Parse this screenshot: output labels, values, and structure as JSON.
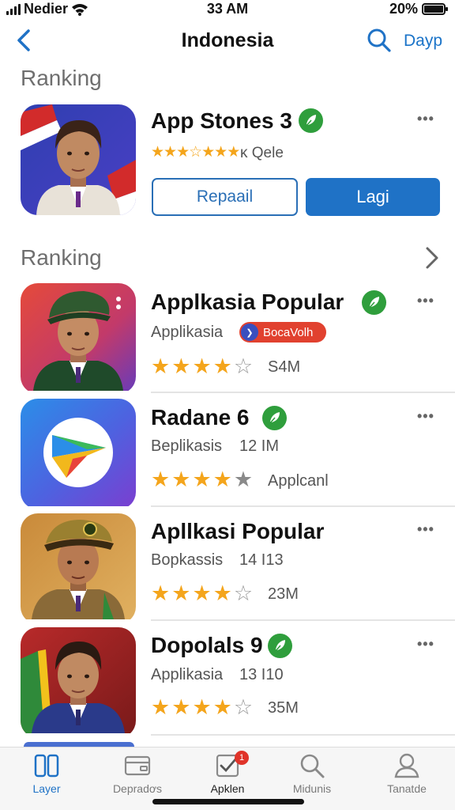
{
  "status_bar": {
    "carrier": "Nedier",
    "time": "33 AM",
    "battery": "20%"
  },
  "nav": {
    "title": "Indonesia",
    "right_label": "Dayp",
    "back_icon": "chevron-left-icon",
    "search_icon": "search-icon"
  },
  "featured": {
    "section_title": "Ranking",
    "app_name": "App Stones 3",
    "rating_text": "★★★☆★★★",
    "rating_suffix": "ĸ Qele",
    "more": "•••",
    "btn_secondary": "Repaail",
    "btn_primary": "Lagi"
  },
  "ranking": {
    "section_title": "Ranking",
    "items": [
      {
        "name": "Applkasia Popular",
        "category": "Applikasia",
        "badge": "BocaVolh",
        "rating": 4,
        "size": "S4M",
        "more": "•••"
      },
      {
        "name": "Radane 6",
        "category": "Beplikasis",
        "count": "12 IM",
        "rating": 4,
        "secondary": "Applcanl",
        "more": "•••"
      },
      {
        "name": "Apllkasi Popular",
        "category": "Bopkassis",
        "count": "14 I13",
        "rating": 4,
        "size": "23M",
        "more": "•••"
      },
      {
        "name": "Dopolals 9",
        "category": "Applikasia",
        "count": "13 I10",
        "rating": 4,
        "size": "35M",
        "more": "•••"
      }
    ]
  },
  "tabs": [
    {
      "label": "Layer",
      "icon": "apps-icon",
      "active": true
    },
    {
      "label": "Depradơs",
      "icon": "wallet-icon",
      "active": false
    },
    {
      "label": "Apklen",
      "icon": "checkbox-icon",
      "active": false,
      "badge": "1"
    },
    {
      "label": "Midunis",
      "icon": "search-icon",
      "active": false
    },
    {
      "label": "Tanatde",
      "icon": "person-icon",
      "active": false
    }
  ],
  "colors": {
    "accent": "#1f72c6",
    "verified": "#2f9e3c",
    "star": "#f4a51c",
    "badge_red": "#e1412f"
  }
}
